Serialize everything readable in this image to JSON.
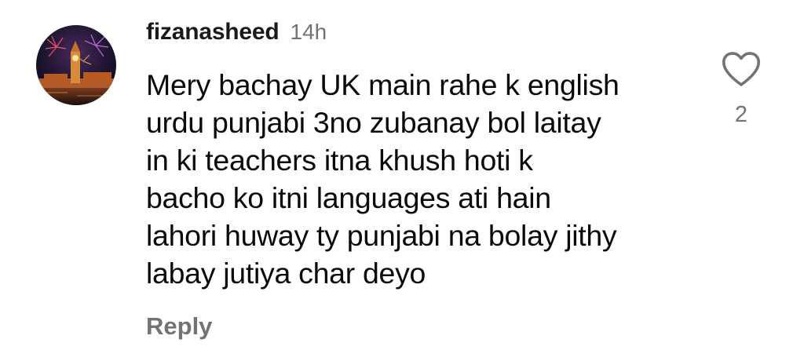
{
  "comment": {
    "username": "fizanasheed",
    "timestamp": "14h",
    "text": "Mery bachay UK main rahe k english\nurdu punjabi 3no zubanay bol laitay\nin ki teachers itna khush hoti k\nbacho ko itni languages ati hain\nlahori huway ty punjabi na bolay jithy\nlabay jutiya char deyo",
    "reply_label": "Reply",
    "like_count": "2",
    "like_icon": "heart-outline-icon"
  },
  "colors": {
    "primary_text": "#0a0a0a",
    "secondary_text": "#737373",
    "background": "#ffffff"
  }
}
